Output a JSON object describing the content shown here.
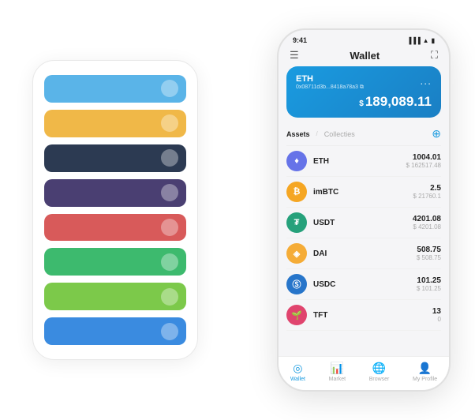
{
  "scene": {
    "bg_cards": [
      {
        "color": "#5ab4e8",
        "dot_color": "rgba(255,255,255,0.4)"
      },
      {
        "color": "#f0b848",
        "dot_color": "rgba(255,255,255,0.4)"
      },
      {
        "color": "#2c3a52",
        "dot_color": "rgba(255,255,255,0.4)"
      },
      {
        "color": "#4a3f72",
        "dot_color": "rgba(255,255,255,0.4)"
      },
      {
        "color": "#d85a5a",
        "dot_color": "rgba(255,255,255,0.4)"
      },
      {
        "color": "#3dba6e",
        "dot_color": "rgba(255,255,255,0.4)"
      },
      {
        "color": "#7cc94a",
        "dot_color": "rgba(255,255,255,0.4)"
      },
      {
        "color": "#3a8be0",
        "dot_color": "rgba(255,255,255,0.4)"
      }
    ]
  },
  "phone": {
    "status_time": "9:41",
    "header_title": "Wallet",
    "eth_card": {
      "label": "ETH",
      "address": "0x08711d3b...8418a78a3",
      "more": "...",
      "dollar_sign": "$",
      "balance": "189,089.11"
    },
    "assets_tab_active": "Assets",
    "assets_tab_separator": "/",
    "assets_tab_inactive": "Collecties",
    "assets": [
      {
        "name": "ETH",
        "amount": "1004.01",
        "usd": "$ 162517.48",
        "bg": "#6673e8",
        "symbol": "♦"
      },
      {
        "name": "imBTC",
        "amount": "2.5",
        "usd": "$ 21760.1",
        "bg": "#f5a623",
        "symbol": "₿"
      },
      {
        "name": "USDT",
        "amount": "4201.08",
        "usd": "$ 4201.08",
        "bg": "#26a17b",
        "symbol": "₮"
      },
      {
        "name": "DAI",
        "amount": "508.75",
        "usd": "$ 508.75",
        "bg": "#f5ac37",
        "symbol": "◈"
      },
      {
        "name": "USDC",
        "amount": "101.25",
        "usd": "$ 101.25",
        "bg": "#2775ca",
        "symbol": "Ⓢ"
      },
      {
        "name": "TFT",
        "amount": "13",
        "usd": "0",
        "bg": "#e0446e",
        "symbol": "🌱"
      }
    ],
    "nav": [
      {
        "label": "Wallet",
        "active": true,
        "icon": "◎"
      },
      {
        "label": "Market",
        "active": false,
        "icon": "📊"
      },
      {
        "label": "Browser",
        "active": false,
        "icon": "🌐"
      },
      {
        "label": "My Profile",
        "active": false,
        "icon": "👤"
      }
    ]
  }
}
